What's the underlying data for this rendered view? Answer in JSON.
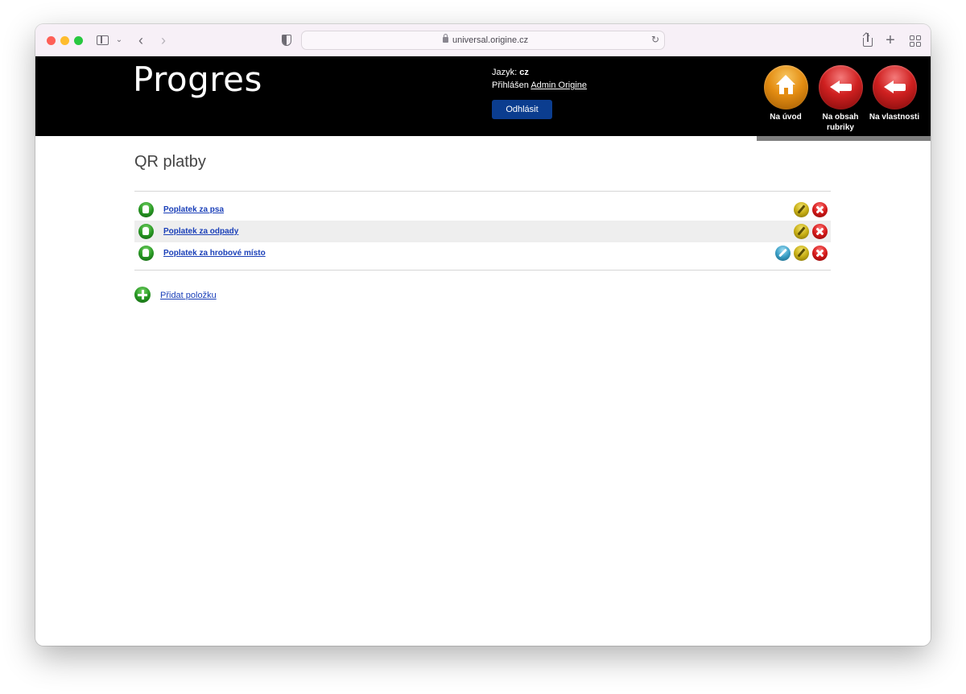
{
  "browser": {
    "url": "universal.origine.cz"
  },
  "header": {
    "logo": "Progres",
    "language_label": "Jazyk: ",
    "language_value": "cz",
    "logged_label": "Přihlášen ",
    "logged_user": "Admin Origine",
    "logout_label": "Odhlásit",
    "nav": [
      {
        "label": "Na úvod",
        "icon": "home-icon"
      },
      {
        "label": "Na obsah rubriky",
        "icon": "back-arrow-icon"
      },
      {
        "label": "Na vlastnosti",
        "icon": "back-arrow-icon"
      }
    ]
  },
  "main": {
    "title": "QR platby",
    "items": [
      {
        "label": "Poplatek za psa",
        "actions": [
          "edit-icon",
          "delete-icon"
        ]
      },
      {
        "label": "Poplatek za odpady",
        "actions": [
          "edit-icon",
          "delete-icon"
        ]
      },
      {
        "label": "Poplatek za hrobové místo",
        "actions": [
          "wrench-icon",
          "edit-icon",
          "delete-icon"
        ]
      }
    ],
    "add_label": "Přidat položku"
  },
  "colors": {
    "header_bg": "#000000",
    "link": "#1a3fb8",
    "button": "#0b3d8f",
    "row_alt": "#eeeeee"
  }
}
